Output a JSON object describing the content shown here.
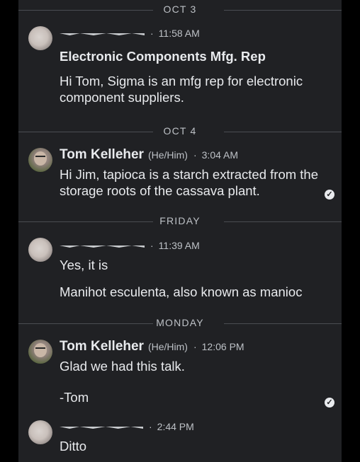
{
  "dividers": {
    "d1": "OCT 3",
    "d2": "OCT 4",
    "d3": "FRIDAY",
    "d4": "MONDAY"
  },
  "messages": [
    {
      "sender": "",
      "time": "11:58 AM",
      "subject": "Electronic Components Mfg. Rep",
      "lines": [
        "Hi Tom, Sigma is an mfg rep for electronic component suppliers."
      ]
    },
    {
      "sender": "Tom Kelleher",
      "pronouns": "(He/Him)",
      "time": "3:04 AM",
      "lines": [
        "Hi Jim, tapioca is a starch extracted from the storage roots of the cassava plant."
      ],
      "status_icon": "check-circle-icon"
    },
    {
      "sender": "",
      "time": "11:39 AM",
      "lines": [
        "Yes, it is",
        "Manihot esculenta, also known as manioc"
      ]
    },
    {
      "sender": "Tom Kelleher",
      "pronouns": "(He/Him)",
      "time": "12:06 PM",
      "lines": [
        "Glad we had this talk.",
        "-Tom"
      ],
      "status_icon": "check-circle-icon"
    },
    {
      "sender": "",
      "time": "2:44 PM",
      "lines": [
        "Ditto"
      ]
    }
  ],
  "separator": "·",
  "check_glyph": "✓",
  "colors": {
    "background": "#202124",
    "text": "#e8eaed",
    "muted": "#bdc1c6"
  }
}
